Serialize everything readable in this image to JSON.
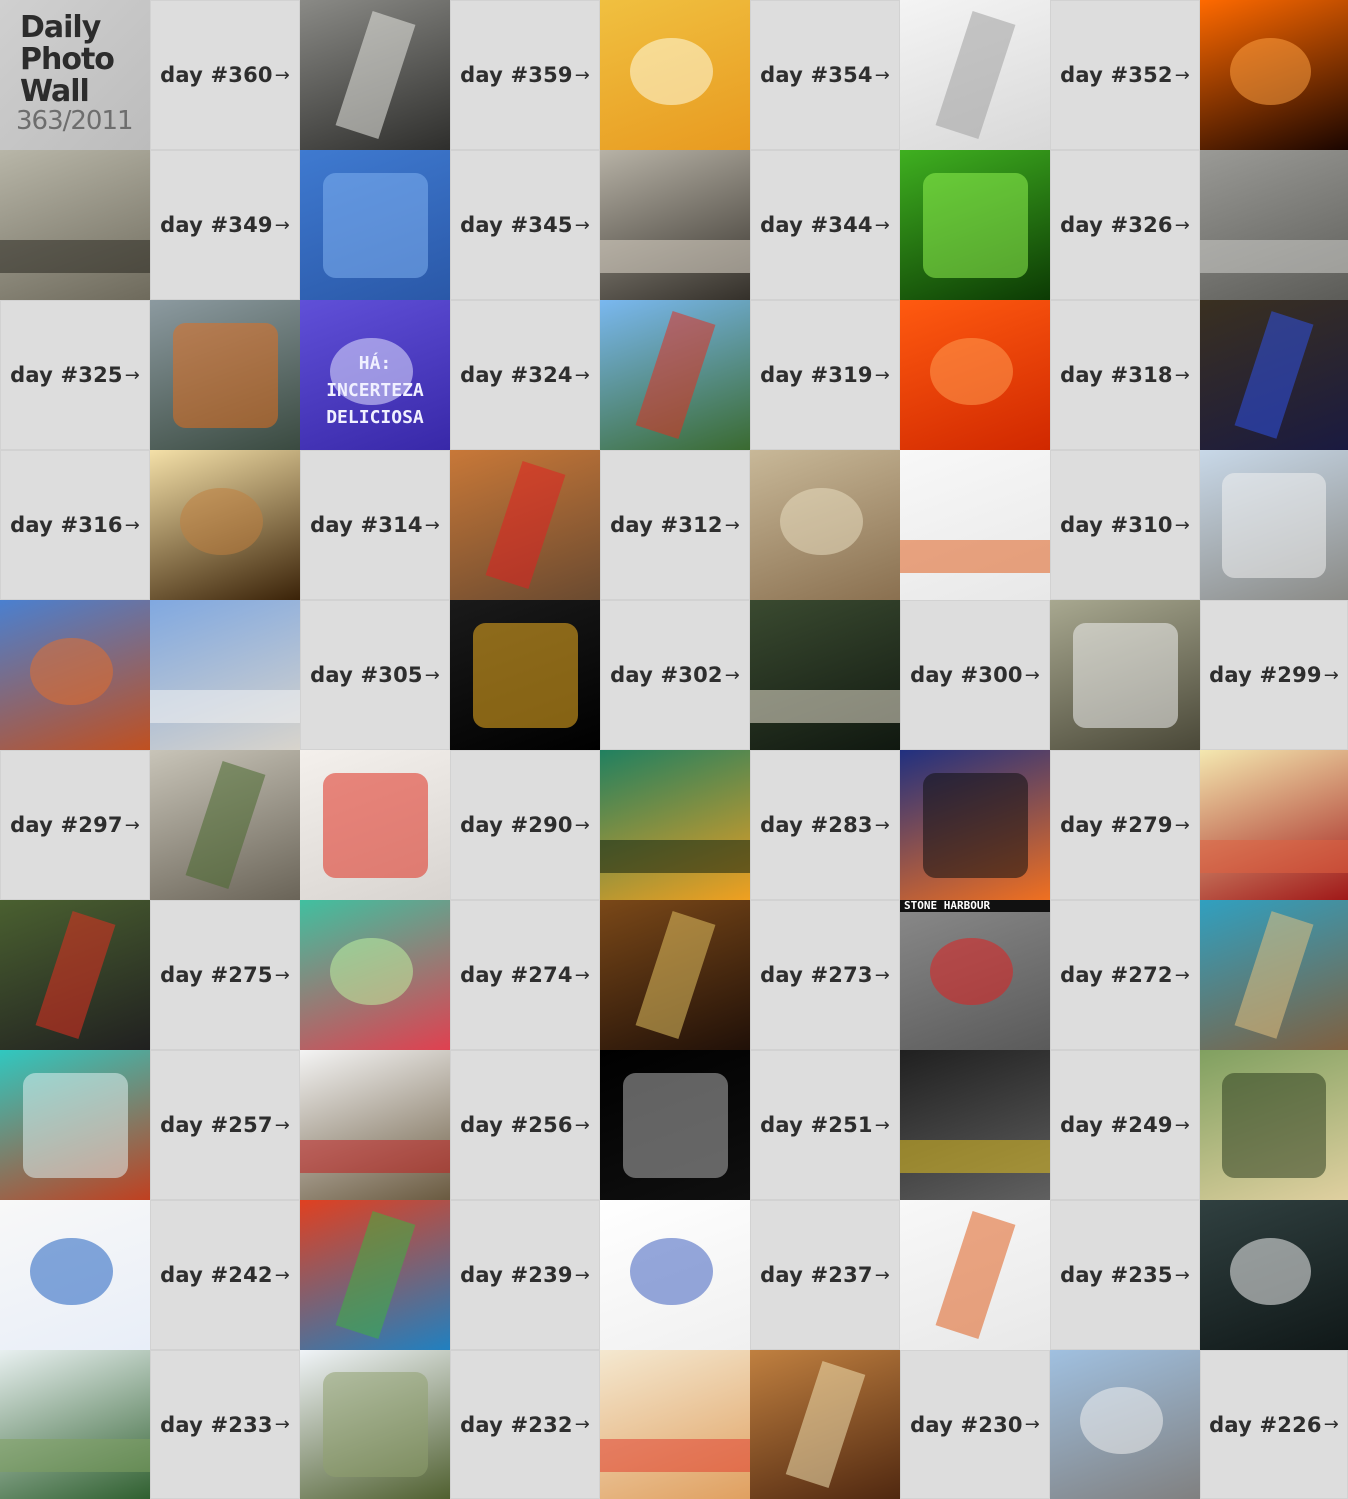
{
  "title": {
    "lines": [
      "Daily",
      "Photo",
      "Wall"
    ],
    "subtitle": "363/2011"
  },
  "arrow": "→",
  "grid": [
    [
      {
        "t": "title"
      },
      {
        "t": "label",
        "text": "day #360"
      },
      {
        "t": "photo",
        "c1": "#8a8a86",
        "c2": "#2e2e2c",
        "accent": "#e8e8e2"
      },
      {
        "t": "label",
        "text": "day #359"
      },
      {
        "t": "photo",
        "c1": "#f0c040",
        "c2": "#e89a20",
        "accent": "#fffbe0"
      },
      {
        "t": "label",
        "text": "day #354"
      },
      {
        "t": "photo",
        "c1": "#f4f4f4",
        "c2": "#d8d8d8",
        "accent": "#a0a0a0"
      },
      {
        "t": "label",
        "text": "day #352"
      },
      {
        "t": "photo",
        "c1": "#ff6a00",
        "c2": "#1a0500",
        "accent": "#ffa040"
      }
    ],
    [
      {
        "t": "photo",
        "c1": "#b8b6a8",
        "c2": "#6e6a5c",
        "accent": "#2a2820"
      },
      {
        "t": "label",
        "text": "day #349"
      },
      {
        "t": "photo",
        "c1": "#3f7ad0",
        "c2": "#2a58a8",
        "accent": "#80b0f0"
      },
      {
        "t": "label",
        "text": "day #345"
      },
      {
        "t": "photo",
        "c1": "#b7b2a6",
        "c2": "#34302a",
        "accent": "#e0d8cc"
      },
      {
        "t": "label",
        "text": "day #344"
      },
      {
        "t": "photo",
        "c1": "#3fb020",
        "c2": "#0c3a04",
        "accent": "#90f050"
      },
      {
        "t": "label",
        "text": "day #326"
      },
      {
        "t": "photo",
        "c1": "#9a9a96",
        "c2": "#5c5c58",
        "accent": "#d0d0cc"
      }
    ],
    [
      {
        "t": "label",
        "text": "day #325"
      },
      {
        "t": "photo",
        "c1": "#8c9aa0",
        "c2": "#3a4a40",
        "accent": "#e07020"
      },
      {
        "t": "photo",
        "c1": "#6050d8",
        "c2": "#3828a8",
        "accent": "#e0e0ff",
        "caption": [
          "HÁ:",
          "INCERTEZA",
          "DELICIOSA"
        ]
      },
      {
        "t": "label",
        "text": "day #324"
      },
      {
        "t": "photo",
        "c1": "#7ab8f0",
        "c2": "#3a6a30",
        "accent": "#e03020"
      },
      {
        "t": "label",
        "text": "day #319"
      },
      {
        "t": "photo",
        "c1": "#ff5a10",
        "c2": "#d02800",
        "accent": "#ff9a50"
      },
      {
        "t": "label",
        "text": "day #318"
      },
      {
        "t": "photo",
        "c1": "#3a3020",
        "c2": "#1a1a40",
        "accent": "#3050e0"
      }
    ],
    [
      {
        "t": "label",
        "text": "day #316"
      },
      {
        "t": "photo",
        "c1": "#f4e0a8",
        "c2": "#3a2208",
        "accent": "#c08040"
      },
      {
        "t": "label",
        "text": "day #314"
      },
      {
        "t": "photo",
        "c1": "#c87838",
        "c2": "#6a4a30",
        "accent": "#e02020"
      },
      {
        "t": "label",
        "text": "day #312"
      },
      {
        "t": "photo",
        "c1": "#c8b898",
        "c2": "#8a7050",
        "accent": "#e8dcc0"
      },
      {
        "t": "photo",
        "c1": "#f8f8f8",
        "c2": "#e8e8e8",
        "accent": "#e06020"
      },
      {
        "t": "label",
        "text": "day #310"
      },
      {
        "t": "photo",
        "c1": "#c8d8e8",
        "c2": "#8a8a86",
        "accent": "#f0f0f0"
      }
    ],
    [
      {
        "t": "photo",
        "c1": "#4a80d0",
        "c2": "#c05020",
        "accent": "#e07030"
      },
      {
        "t": "photo",
        "c1": "#80a8e0",
        "c2": "#d8d4cc",
        "accent": "#f4f4f4"
      },
      {
        "t": "label",
        "text": "day #305"
      },
      {
        "t": "photo",
        "c1": "#1a1a1a",
        "c2": "#000000",
        "accent": "#f0b020"
      },
      {
        "t": "label",
        "text": "day #302"
      },
      {
        "t": "photo",
        "c1": "#3a4a30",
        "c2": "#101810",
        "accent": "#e8e0d0"
      },
      {
        "t": "label",
        "text": "day #300"
      },
      {
        "t": "photo",
        "c1": "#a8a890",
        "c2": "#4a4838",
        "accent": "#f0f0f0"
      },
      {
        "t": "label",
        "text": "day #299"
      }
    ],
    [
      {
        "t": "label",
        "text": "day #297"
      },
      {
        "t": "photo",
        "c1": "#c8c4b8",
        "c2": "#6a6458",
        "accent": "#4a6a30"
      },
      {
        "t": "photo",
        "c1": "#f4f0ec",
        "c2": "#d8d4d0",
        "accent": "#e03020"
      },
      {
        "t": "label",
        "text": "day #290"
      },
      {
        "t": "photo",
        "c1": "#208060",
        "c2": "#f0a020",
        "accent": "#102010"
      },
      {
        "t": "label",
        "text": "day #283"
      },
      {
        "t": "photo",
        "c1": "#203080",
        "c2": "#f07020",
        "accent": "#101010"
      },
      {
        "t": "label",
        "text": "day #279"
      },
      {
        "t": "photo",
        "c1": "#f4e8b0",
        "c2": "#a01818",
        "accent": "#e06040"
      }
    ],
    [
      {
        "t": "photo",
        "c1": "#4a6030",
        "c2": "#202020",
        "accent": "#e03020"
      },
      {
        "t": "label",
        "text": "day #275"
      },
      {
        "t": "photo",
        "c1": "#40c0a0",
        "c2": "#e04050",
        "accent": "#c0f0a0"
      },
      {
        "t": "label",
        "text": "day #274"
      },
      {
        "t": "photo",
        "c1": "#7a4818",
        "c2": "#201008",
        "accent": "#e0c060"
      },
      {
        "t": "label",
        "text": "day #273"
      },
      {
        "t": "photo",
        "c1": "#8a8a8a",
        "c2": "#5a5a5a",
        "accent": "#e02020",
        "caption": [
          "STONE HARBOUR"
        ]
      },
      {
        "t": "label",
        "text": "day #272"
      },
      {
        "t": "photo",
        "c1": "#30a0c0",
        "c2": "#806040",
        "accent": "#e0c080"
      }
    ],
    [
      {
        "t": "photo",
        "c1": "#30c8c0",
        "c2": "#c04020",
        "accent": "#e0f0f0"
      },
      {
        "t": "label",
        "text": "day #257"
      },
      {
        "t": "photo",
        "c1": "#f4f4f4",
        "c2": "#6a5a40",
        "accent": "#c02020"
      },
      {
        "t": "label",
        "text": "day #256"
      },
      {
        "t": "photo",
        "c1": "#000000",
        "c2": "#101010",
        "accent": "#b0b0b0"
      },
      {
        "t": "label",
        "text": "day #251"
      },
      {
        "t": "photo",
        "c1": "#202020",
        "c2": "#606060",
        "accent": "#e0c020"
      },
      {
        "t": "label",
        "text": "day #249"
      },
      {
        "t": "photo",
        "c1": "#80a060",
        "c2": "#e0d0a0",
        "accent": "#304020"
      }
    ],
    [
      {
        "t": "photo",
        "c1": "#f8f8f8",
        "c2": "#e8eef8",
        "accent": "#2060c0"
      },
      {
        "t": "label",
        "text": "day #242"
      },
      {
        "t": "photo",
        "c1": "#e04020",
        "c2": "#2080c0",
        "accent": "#40b040"
      },
      {
        "t": "label",
        "text": "day #239"
      },
      {
        "t": "photo",
        "c1": "#ffffff",
        "c2": "#f0f0f0",
        "accent": "#4060c0"
      },
      {
        "t": "label",
        "text": "day #237"
      },
      {
        "t": "photo",
        "c1": "#f8f8f8",
        "c2": "#e8e8e8",
        "accent": "#e06020"
      },
      {
        "t": "label",
        "text": "day #235"
      },
      {
        "t": "photo",
        "c1": "#304040",
        "c2": "#101818",
        "accent": "#f0f0f0"
      }
    ],
    [
      {
        "t": "photo",
        "c1": "#e8f0f0",
        "c2": "#306030",
        "accent": "#80a060"
      },
      {
        "t": "label",
        "text": "day #233"
      },
      {
        "t": "photo",
        "c1": "#f0f4f8",
        "c2": "#506030",
        "accent": "#90a070"
      },
      {
        "t": "label",
        "text": "day #232"
      },
      {
        "t": "photo",
        "c1": "#f4e8d0",
        "c2": "#e0a060",
        "accent": "#e04030"
      },
      {
        "t": "photo",
        "c1": "#c08040",
        "c2": "#502810",
        "accent": "#f0e0b0"
      },
      {
        "t": "label",
        "text": "day #230"
      },
      {
        "t": "photo",
        "c1": "#a0c0e0",
        "c2": "#808080",
        "accent": "#f0f0f0"
      },
      {
        "t": "label",
        "text": "day #226"
      }
    ]
  ]
}
